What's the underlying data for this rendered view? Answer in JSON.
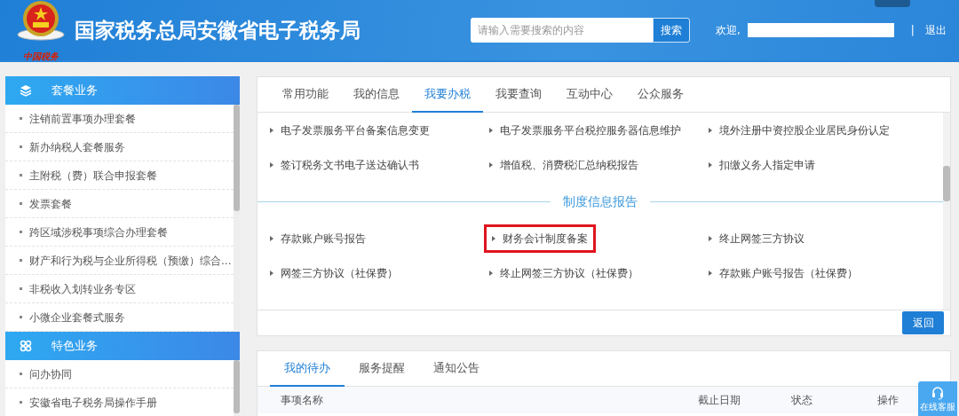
{
  "header": {
    "title": "国家税务总局安徽省电子税务局",
    "logo_caption": "中国税务",
    "search": {
      "placeholder": "请输入需要搜索的内容",
      "button": "搜索"
    },
    "welcome": "欢迎,",
    "separator": "|",
    "logout": "退出"
  },
  "sidebar": [
    {
      "title": "套餐业务",
      "items": [
        "注销前置事项办理套餐",
        "新办纳税人套餐服务",
        "主附税（费）联合申报套餐",
        "发票套餐",
        "跨区域涉税事项综合办理套餐",
        "财产和行为税与企业所得税（预缴）综合...",
        "非税收入划转业务专区",
        "小微企业套餐式服务"
      ]
    },
    {
      "title": "特色业务",
      "items": [
        "问办协同",
        "安徽省电子税务局操作手册"
      ]
    }
  ],
  "main_panel": {
    "tabs": [
      {
        "label": "常用功能",
        "selected": false
      },
      {
        "label": "我的信息",
        "selected": false
      },
      {
        "label": "我要办税",
        "selected": true
      },
      {
        "label": "我要查询",
        "selected": false
      },
      {
        "label": "互动中心",
        "selected": false
      },
      {
        "label": "公众服务",
        "selected": false
      }
    ],
    "sections": [
      {
        "items": [
          {
            "label": "电子发票服务平台备案信息变更",
            "highlighted": false
          },
          {
            "label": "电子发票服务平台税控服务器信息维护",
            "highlighted": false
          },
          {
            "label": "境外注册中资控股企业居民身份认定",
            "highlighted": false
          },
          {
            "label": "签订税务文书电子送达确认书",
            "highlighted": false
          },
          {
            "label": "增值税、消费税汇总纳税报告",
            "highlighted": false
          },
          {
            "label": "扣缴义务人指定申请",
            "highlighted": false
          }
        ]
      },
      {
        "heading": "制度信息报告",
        "items": [
          {
            "label": "存款账户账号报告",
            "highlighted": false
          },
          {
            "label": "财务会计制度备案",
            "highlighted": true
          },
          {
            "label": "终止网签三方协议",
            "highlighted": false
          },
          {
            "label": "网签三方协议（社保费）",
            "highlighted": false
          },
          {
            "label": "终止网签三方协议（社保费）",
            "highlighted": false
          },
          {
            "label": "存款账户账号报告（社保费）",
            "highlighted": false
          }
        ]
      }
    ],
    "back_button": "返回"
  },
  "bottom_panel": {
    "tabs": [
      {
        "label": "我的待办",
        "selected": true
      },
      {
        "label": "服务提醒",
        "selected": false
      },
      {
        "label": "通知公告",
        "selected": false
      }
    ],
    "columns": [
      "事项名称",
      "截止日期",
      "状态",
      "操作"
    ]
  },
  "chat_button": "在线客服"
}
